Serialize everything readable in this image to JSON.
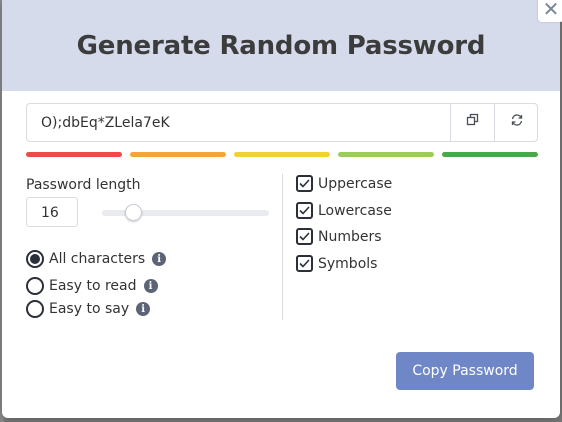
{
  "dialog": {
    "title": "Generate Random Password",
    "close_label": "✕"
  },
  "password": {
    "value": "O);dbEq*ZLela7eK",
    "copy_icon": "copy-icon",
    "refresh_icon": "refresh-icon"
  },
  "strength_colors": [
    "#ef4a4a",
    "#f3a53a",
    "#f1d234",
    "#9ccd5a",
    "#4aa84a"
  ],
  "length": {
    "label": "Password length",
    "value": "16",
    "slider_fraction": 0.15
  },
  "character_modes": [
    {
      "label": "All characters",
      "selected": true
    },
    {
      "label": "Easy to read",
      "selected": false
    },
    {
      "label": "Easy to say",
      "selected": false
    }
  ],
  "options": [
    {
      "label": "Uppercase",
      "checked": true
    },
    {
      "label": "Lowercase",
      "checked": true
    },
    {
      "label": "Numbers",
      "checked": true
    },
    {
      "label": "Symbols",
      "checked": true
    }
  ],
  "info_icon_glyph": "i",
  "copy_button_label": "Copy Password",
  "accent_color": "#6f87c6"
}
